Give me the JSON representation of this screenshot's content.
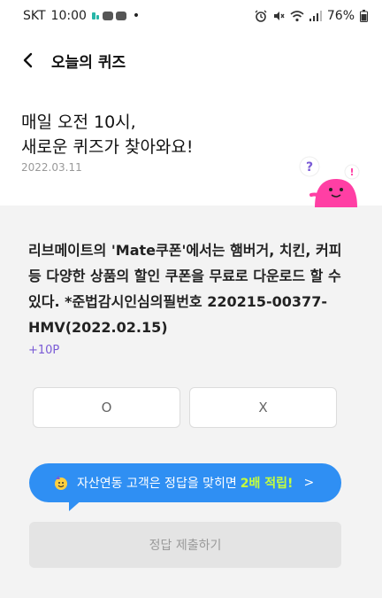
{
  "status_bar": {
    "carrier": "SKT",
    "time": "10:00",
    "dot": "•",
    "battery": "76%",
    "icons": [
      "notification-icons",
      "alarm-icon",
      "mute-icon",
      "wifi-icon",
      "signal-icon",
      "battery-icon"
    ]
  },
  "header": {
    "title": "오늘의 퀴즈"
  },
  "hero": {
    "title": "매일 오전 10시,\n새로운 퀴즈가 찾아와요!",
    "date": "2022.03.11"
  },
  "quiz": {
    "question": "리브메이트의 'Mate쿠폰'에서는 햄버거, 치킨, 커피 등 다양한 상품의 할인 쿠폰을 무료로 다운로드 할 수 있다. *준법감시인심의필번호 220215-00377-HMV(2022.02.15)",
    "points": "+10P",
    "option_o": "O",
    "option_x": "X"
  },
  "promo": {
    "text": "자산연동 고객은 정답을 맞히면",
    "highlight": "2배 적립!",
    "arrow": ">"
  },
  "submit": {
    "label": "정답 제출하기"
  },
  "colors": {
    "accent_blue": "#2f8ff3",
    "highlight_green": "#c5ff3d",
    "points_purple": "#7a5bd6",
    "mascot_pink": "#ff3fa4"
  }
}
